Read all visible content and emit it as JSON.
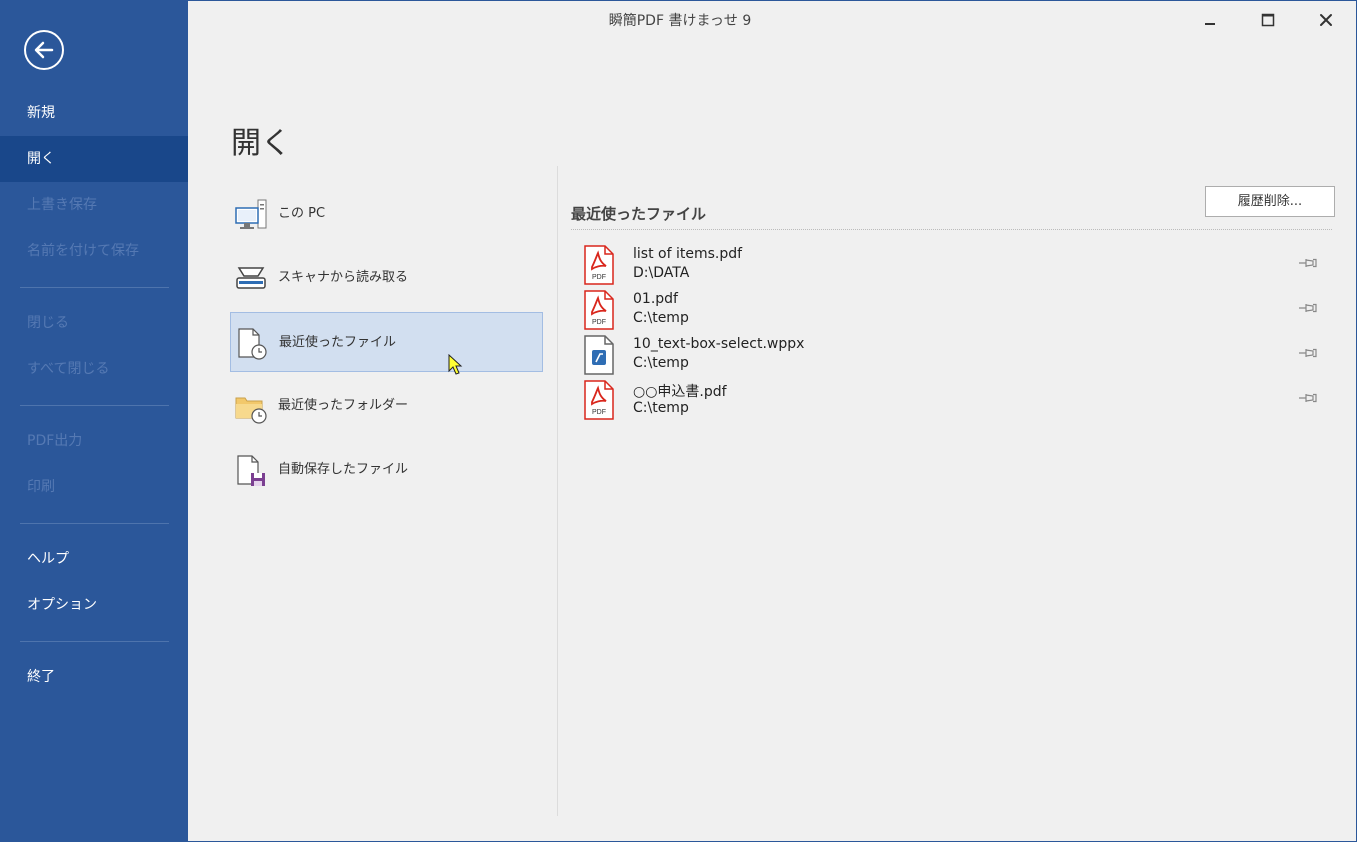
{
  "window": {
    "title": "瞬簡PDF 書けまっせ 9"
  },
  "sidebar": {
    "items": [
      {
        "label": "新規",
        "state": "normal"
      },
      {
        "label": "開く",
        "state": "active"
      },
      {
        "label": "上書き保存",
        "state": "disabled"
      },
      {
        "label": "名前を付けて保存",
        "state": "disabled"
      },
      {
        "label": "閉じる",
        "state": "disabled"
      },
      {
        "label": "すべて閉じる",
        "state": "disabled"
      },
      {
        "label": "PDF出力",
        "state": "disabled"
      },
      {
        "label": "印刷",
        "state": "disabled"
      },
      {
        "label": "ヘルプ",
        "state": "normal"
      },
      {
        "label": "オプション",
        "state": "normal"
      },
      {
        "label": "終了",
        "state": "normal"
      }
    ]
  },
  "main": {
    "heading": "開く",
    "open_options": [
      {
        "label": "この PC",
        "icon": "computer-icon"
      },
      {
        "label": "スキャナから読み取る",
        "icon": "scanner-icon"
      },
      {
        "label": "最近使ったファイル",
        "icon": "recent-file-icon",
        "selected": true
      },
      {
        "label": "最近使ったフォルダー",
        "icon": "recent-folder-icon"
      },
      {
        "label": "自動保存したファイル",
        "icon": "autosave-file-icon"
      }
    ],
    "recent": {
      "title": "最近使ったファイル",
      "clear_button": "履歴削除...",
      "files": [
        {
          "name": "list of items.pdf",
          "path": "D:\\DATA",
          "type": "pdf"
        },
        {
          "name": "01.pdf",
          "path": "C:\\temp",
          "type": "pdf"
        },
        {
          "name": "10_text-box-select.wppx",
          "path": "C:\\temp",
          "type": "wppx"
        },
        {
          "name": "○○申込書.pdf",
          "path": "C:\\temp",
          "type": "pdf"
        }
      ]
    }
  },
  "colors": {
    "sidebar_bg": "#2b579a",
    "sidebar_active": "#19478a",
    "selected_bg": "#d2dff0",
    "pdf_red": "#d9261c"
  }
}
